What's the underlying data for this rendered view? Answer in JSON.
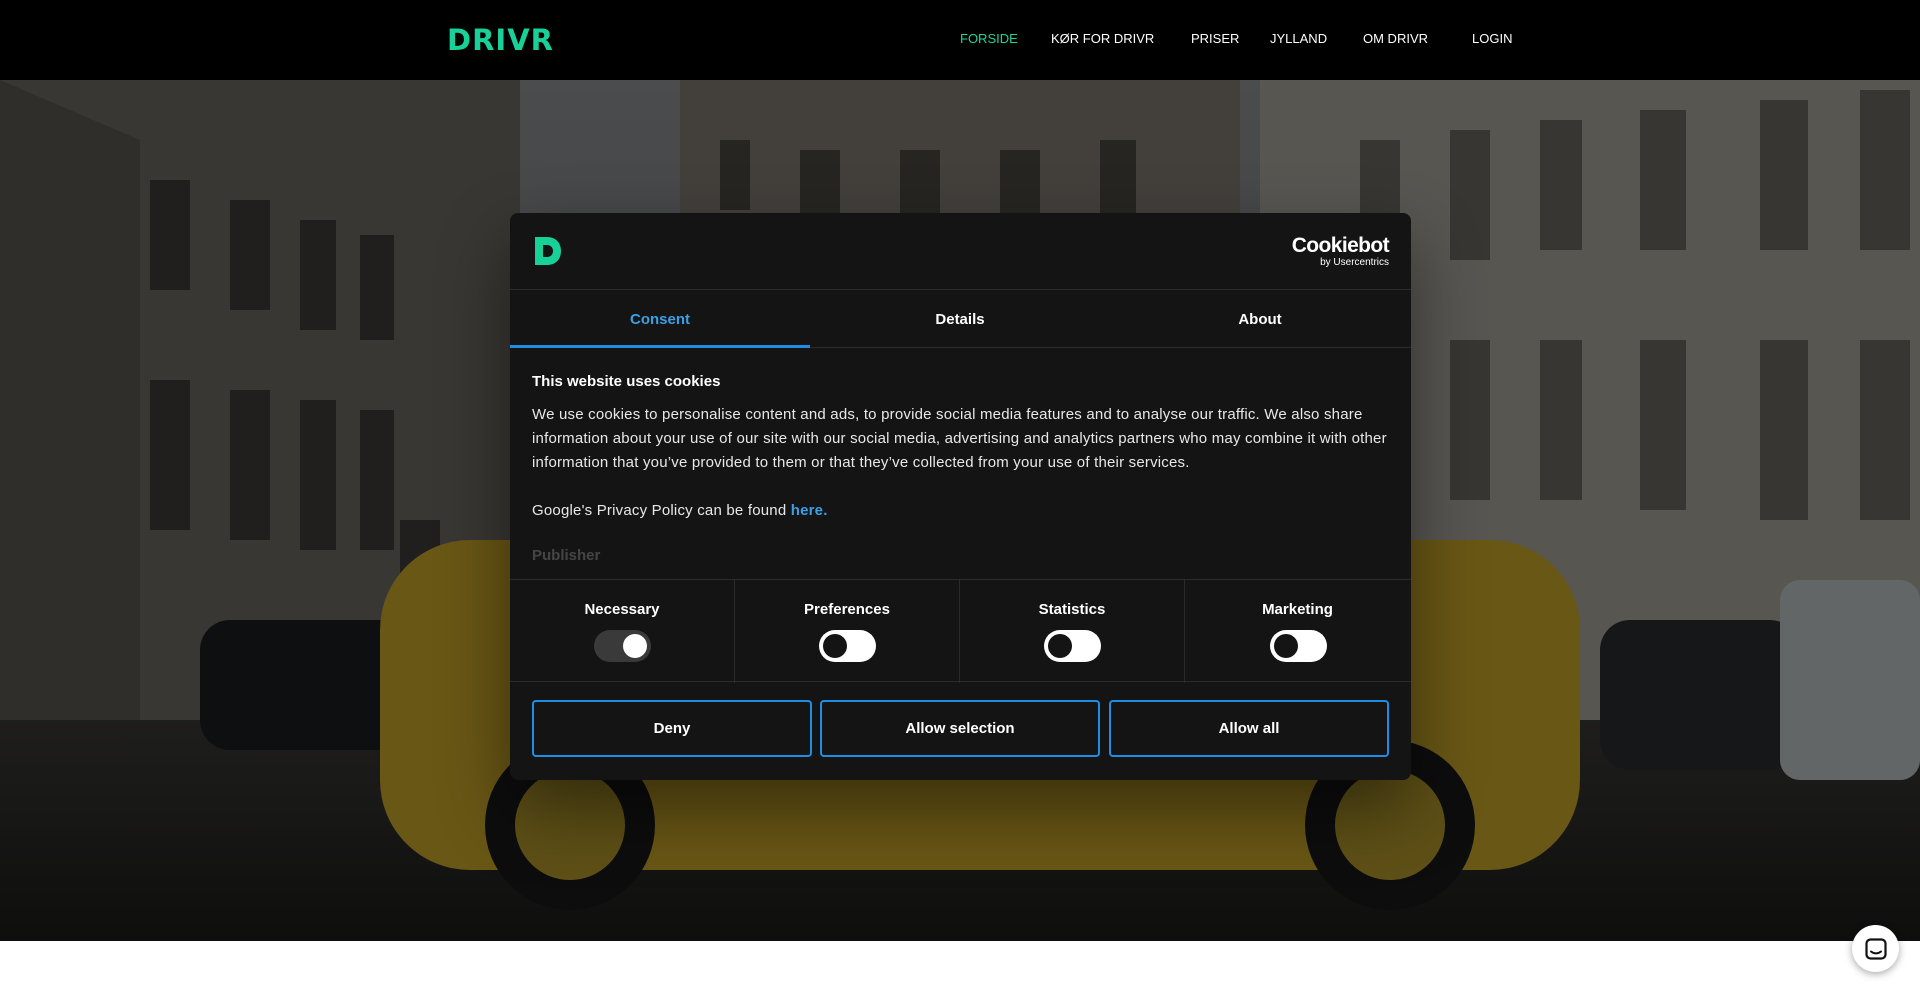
{
  "header": {
    "logo": "DRIVR",
    "nav": [
      {
        "label": "FORSIDE",
        "active": true
      },
      {
        "label": "KØR FOR DRIVR",
        "active": false
      },
      {
        "label": "PRISER",
        "active": false
      },
      {
        "label": "JYLLAND",
        "active": false
      },
      {
        "label": "OM DRIVR",
        "active": false
      },
      {
        "label": "LOGIN",
        "active": false
      }
    ]
  },
  "dialog": {
    "brand": {
      "main": "Cookiebot",
      "sub": "by Usercentrics"
    },
    "tabs": [
      {
        "label": "Consent",
        "active": true
      },
      {
        "label": "Details",
        "active": false
      },
      {
        "label": "About",
        "active": false
      }
    ],
    "title": "This website uses cookies",
    "text": "We use cookies to personalise content and ads, to provide social media features and to analyse our traffic. We also share information about your use of our site with our social media, advertising and analytics partners who may combine it with other information that you’ve provided to them or that they’ve collected from your use of their services.",
    "privacy_prefix": "Google's Privacy Policy can be found ",
    "privacy_link": "here.",
    "publisher": "Publisher",
    "toggles": [
      {
        "label": "Necessary",
        "on": true
      },
      {
        "label": "Preferences",
        "on": false
      },
      {
        "label": "Statistics",
        "on": false
      },
      {
        "label": "Marketing",
        "on": false
      }
    ],
    "buttons": {
      "deny": "Deny",
      "allow_selection": "Allow selection",
      "allow_all": "Allow all"
    }
  },
  "colors": {
    "brand_green": "#17d198",
    "accent_blue": "#1f8de3",
    "dialog_bg": "#141414"
  },
  "icons": {
    "dialog_logo": "drivr-d-icon",
    "chat": "chat-bubble-icon"
  }
}
